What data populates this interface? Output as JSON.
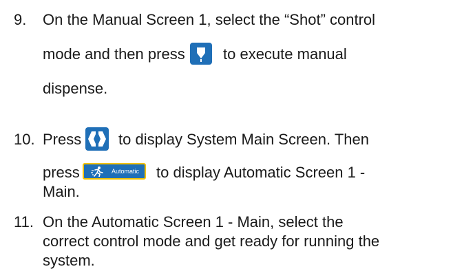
{
  "steps": [
    {
      "number": "9.",
      "line1": "On the Manual Screen 1, select the “Shot” control",
      "line2_before": "mode and then press",
      "line2_after": "to execute manual",
      "line3": "dispense."
    },
    {
      "number": "10.",
      "line1_before": "Press",
      "line1_after": "to display System Main Screen. Then",
      "line2_before": "press",
      "line2_after": "to display Automatic Screen 1 -",
      "line3": "Main.",
      "button_label": "Automatic"
    },
    {
      "number": "11.",
      "line1": "On the Automatic Screen 1 - Main, select the",
      "line2": "correct control mode and get ready for running the",
      "line3": "system."
    }
  ],
  "icons": {
    "dispense": "manual-dispense-icon",
    "home": "graco-logo-icon",
    "automatic": "running-figure-icon"
  },
  "colors": {
    "button_blue": "#1f6fb7",
    "highlight_border": "#f2c200",
    "text": "#1a1a1a"
  }
}
